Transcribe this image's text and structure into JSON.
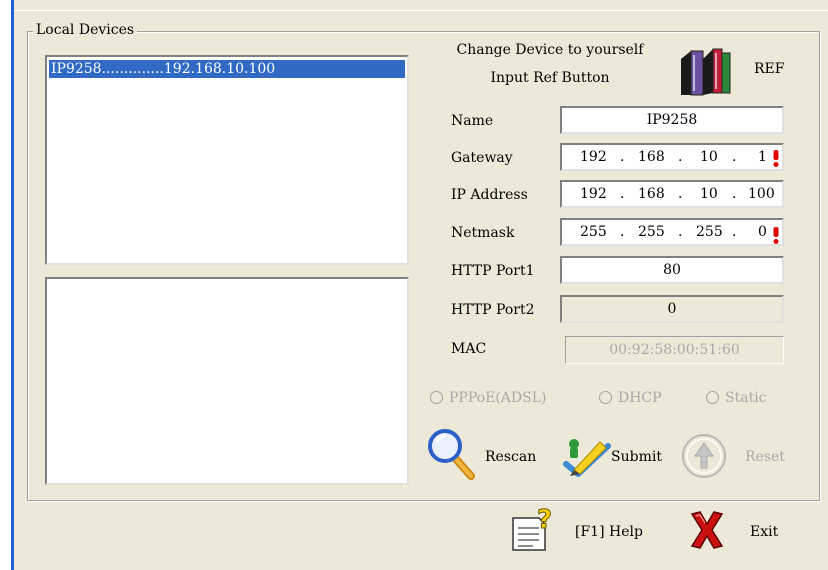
{
  "group": {
    "title": "Local Devices"
  },
  "devices": [
    {
      "label": "IP9258..............192.168.10.100"
    }
  ],
  "hint": {
    "line1": "Change Device to yourself",
    "line2": "Input Ref Button"
  },
  "ref": {
    "label": "REF"
  },
  "fields": {
    "name": {
      "label": "Name",
      "value": "IP9258"
    },
    "gateway": {
      "label": "Gateway",
      "octets": [
        "192",
        "168",
        "10",
        "1"
      ]
    },
    "ip": {
      "label": "IP Address",
      "octets": [
        "192",
        "168",
        "10",
        "100"
      ]
    },
    "netmask": {
      "label": "Netmask",
      "octets": [
        "255",
        "255",
        "255",
        "0"
      ]
    },
    "port1": {
      "label": "HTTP Port1",
      "value": "80"
    },
    "port2": {
      "label": "HTTP Port2",
      "value": "0"
    },
    "mac": {
      "label": "MAC",
      "value": "00:92:58:00:51:60"
    }
  },
  "radios": {
    "pppoe": "PPPoE(ADSL)",
    "dhcp": "DHCP",
    "static": "Static"
  },
  "buttons": {
    "rescan": "Rescan",
    "submit": "Submit",
    "reset": "Reset",
    "help": "[F1] Help",
    "exit": "Exit"
  },
  "icons": {
    "ref": "books-icon",
    "rescan": "magnifier-icon",
    "submit": "pen-check-icon",
    "reset": "up-arrow-icon",
    "help": "help-document-icon",
    "exit": "red-x-icon"
  },
  "colors": {
    "selection": "#316ac5",
    "warning": "#e00000",
    "disabled_text": "#a8a8a8",
    "window_bg": "#ece9d8"
  }
}
